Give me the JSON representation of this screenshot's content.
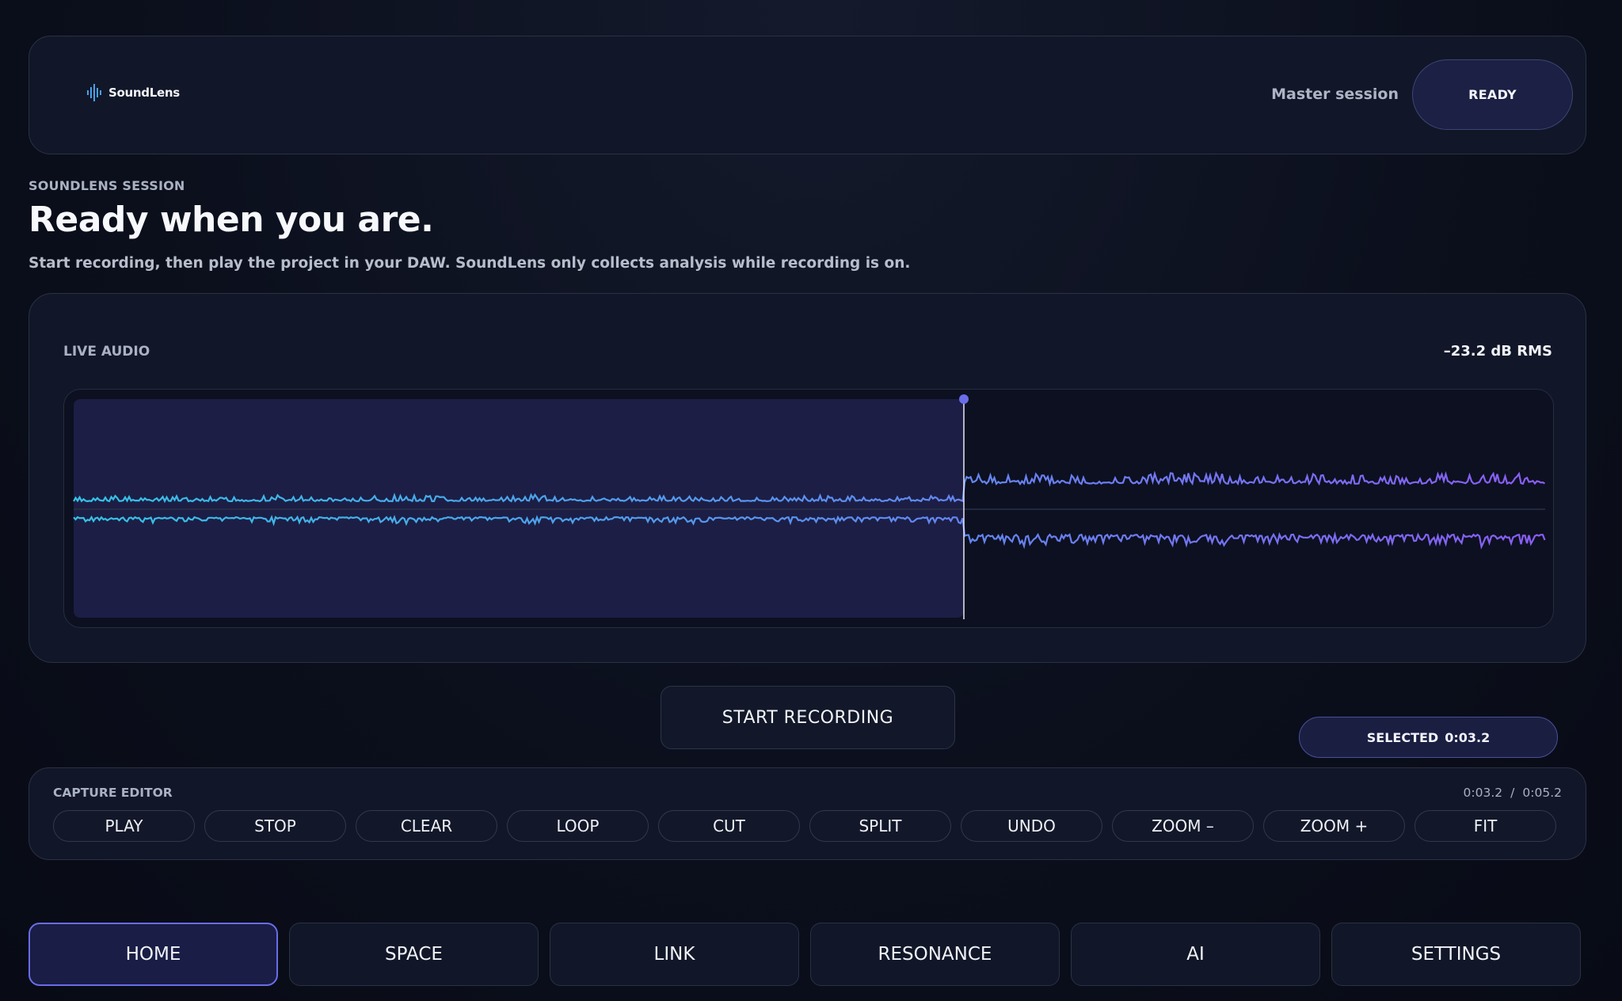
{
  "header": {
    "brand_name": "SoundLens",
    "session_label": "Master session",
    "status_button": "READY"
  },
  "hero": {
    "kicker": "SOUNDLENS SESSION",
    "title": "Ready when you are.",
    "subtitle": "Start recording, then play the project in your DAW. SoundLens only collects analysis while recording is on."
  },
  "live_audio": {
    "label": "LIVE AUDIO",
    "rms": "–23.2 dB RMS"
  },
  "record_button": "START RECORDING",
  "selection": {
    "label": "SELECTED",
    "value": "0:03.2"
  },
  "editor": {
    "label": "CAPTURE EDITOR",
    "current_time": "0:03.2",
    "separator": "/",
    "total_time": "0:05.2",
    "buttons": [
      "PLAY",
      "STOP",
      "CLEAR",
      "LOOP",
      "CUT",
      "SPLIT",
      "UNDO",
      "ZOOM –",
      "ZOOM +",
      "FIT"
    ]
  },
  "nav": {
    "items": [
      "HOME",
      "SPACE",
      "LINK",
      "RESONANCE",
      "AI",
      "SETTINGS"
    ],
    "active": "HOME"
  },
  "colors": {
    "accent": "#6a6de8",
    "wave_start": "#35c3e6",
    "wave_end": "#8a5cf5",
    "selection_fill": "#1c1e45"
  }
}
